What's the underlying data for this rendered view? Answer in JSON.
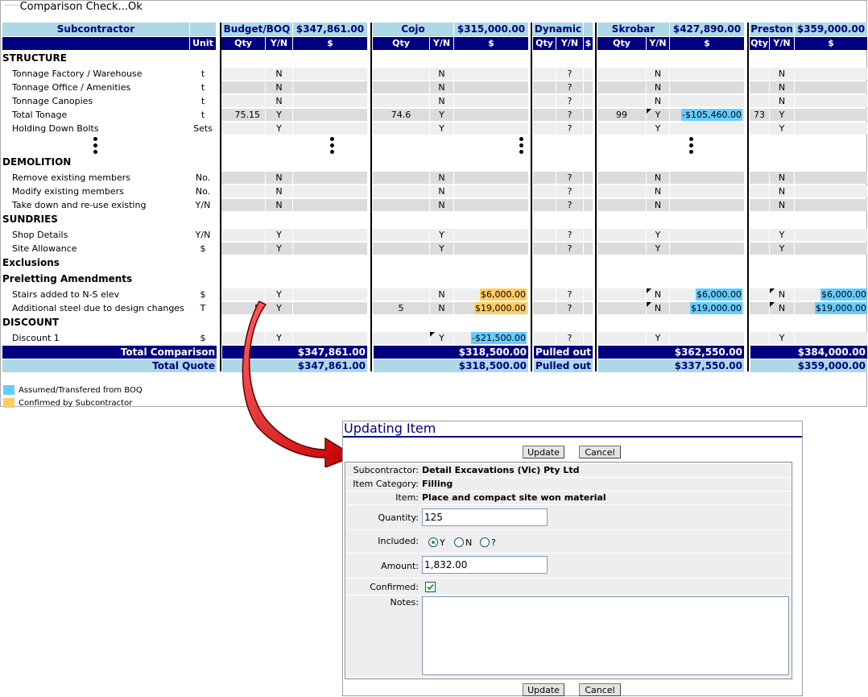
{
  "title": "Comparison Check...Ok",
  "header": {
    "subcontractor_label": "Subcontractor",
    "unit_label": "Unit",
    "groups": [
      {
        "name": "Budget/BOQ",
        "total": "$347,861.00"
      },
      {
        "name": "Cojo",
        "total": "$315,000.00"
      },
      {
        "name": "Dynamic",
        "total": ""
      },
      {
        "name": "Skrobar",
        "total": "$427,890.00"
      },
      {
        "name": "Preston",
        "total": "$359,000.00"
      }
    ],
    "col_qty": "Qty",
    "col_yn": "Y/N",
    "col_dollar": "$"
  },
  "sections": {
    "structure": "STRUCTURE",
    "demolition": "DEMOLITION",
    "sundries": "SUNDRIES",
    "exclusions": "Exclusions",
    "preletting": "Preletting Amendments",
    "discount": "DISCOUNT"
  },
  "rows": [
    {
      "label": "Tonnage Factory / Warehouse",
      "unit": "t",
      "b_qty": "",
      "b_yn": "N",
      "c_qty": "",
      "c_yn": "N",
      "c_amt": "",
      "d_yn": "?",
      "s_qty": "",
      "s_yn": "N",
      "s_amt": "",
      "p_qty": "",
      "p_yn": "N",
      "p_amt": ""
    },
    {
      "label": "Tonnage Office / Amenities",
      "unit": "t",
      "b_qty": "",
      "b_yn": "N",
      "c_qty": "",
      "c_yn": "N",
      "c_amt": "",
      "d_yn": "?",
      "s_qty": "",
      "s_yn": "N",
      "s_amt": "",
      "p_qty": "",
      "p_yn": "N",
      "p_amt": ""
    },
    {
      "label": "Tonnage Canopies",
      "unit": "t",
      "b_qty": "",
      "b_yn": "N",
      "c_qty": "",
      "c_yn": "N",
      "c_amt": "",
      "d_yn": "?",
      "s_qty": "",
      "s_yn": "N",
      "s_amt": "",
      "p_qty": "",
      "p_yn": "N",
      "p_amt": ""
    },
    {
      "label": "Total Tonage",
      "unit": "t",
      "b_qty": "75.15",
      "b_yn": "Y",
      "c_qty": "74.6",
      "c_yn": "Y",
      "c_amt": "",
      "d_yn": "?",
      "s_qty": "99",
      "s_yn": "Y",
      "s_amt": "-$105,460.00",
      "p_qty": "73",
      "p_yn": "Y",
      "p_amt": ""
    },
    {
      "label": "Holding Down Bolts",
      "unit": "Sets",
      "b_qty": "",
      "b_yn": "Y",
      "c_qty": "",
      "c_yn": "Y",
      "c_amt": "",
      "d_yn": "?",
      "s_qty": "",
      "s_yn": "Y",
      "s_amt": "",
      "p_qty": "",
      "p_yn": "Y",
      "p_amt": ""
    },
    {
      "label": "Remove existing members",
      "unit": "No.",
      "b_qty": "",
      "b_yn": "N",
      "c_qty": "",
      "c_yn": "N",
      "c_amt": "",
      "d_yn": "?",
      "s_qty": "",
      "s_yn": "N",
      "s_amt": "",
      "p_qty": "",
      "p_yn": "N",
      "p_amt": ""
    },
    {
      "label": "Modify existing members",
      "unit": "No.",
      "b_qty": "",
      "b_yn": "N",
      "c_qty": "",
      "c_yn": "N",
      "c_amt": "",
      "d_yn": "?",
      "s_qty": "",
      "s_yn": "N",
      "s_amt": "",
      "p_qty": "",
      "p_yn": "N",
      "p_amt": ""
    },
    {
      "label": "Take down and re-use existing",
      "unit": "Y/N",
      "b_qty": "",
      "b_yn": "N",
      "c_qty": "",
      "c_yn": "N",
      "c_amt": "",
      "d_yn": "?",
      "s_qty": "",
      "s_yn": "N",
      "s_amt": "",
      "p_qty": "",
      "p_yn": "N",
      "p_amt": ""
    },
    {
      "label": "Shop Details",
      "unit": "Y/N",
      "b_qty": "",
      "b_yn": "Y",
      "c_qty": "",
      "c_yn": "Y",
      "c_amt": "",
      "d_yn": "?",
      "s_qty": "",
      "s_yn": "Y",
      "s_amt": "",
      "p_qty": "",
      "p_yn": "Y",
      "p_amt": ""
    },
    {
      "label": "Site Allowance",
      "unit": "$",
      "b_qty": "",
      "b_yn": "Y",
      "c_qty": "",
      "c_yn": "Y",
      "c_amt": "",
      "d_yn": "?",
      "s_qty": "",
      "s_yn": "Y",
      "s_amt": "",
      "p_qty": "",
      "p_yn": "Y",
      "p_amt": ""
    },
    {
      "label": "Stairs added to N-S elev",
      "unit": "$",
      "b_qty": "",
      "b_yn": "Y",
      "c_qty": "",
      "c_yn": "N",
      "c_amt": "$6,000.00",
      "d_yn": "?",
      "s_qty": "",
      "s_yn": "N",
      "s_amt": "$6,000.00",
      "p_qty": "",
      "p_yn": "N",
      "p_amt": "$6,000.00"
    },
    {
      "label": "Additional steel due to design changes",
      "unit": "T",
      "b_qty": "5",
      "b_yn": "Y",
      "c_qty": "5",
      "c_yn": "N",
      "c_amt": "$19,000.00",
      "d_yn": "?",
      "s_qty": "",
      "s_yn": "N",
      "s_amt": "$19,000.00",
      "p_qty": "",
      "p_yn": "N",
      "p_amt": "$19,000.00"
    },
    {
      "label": "Discount 1",
      "unit": "$",
      "b_qty": "",
      "b_yn": "Y",
      "c_qty": "",
      "c_yn": "Y",
      "c_amt": "-$21,500.00",
      "d_yn": "?",
      "s_qty": "",
      "s_yn": "Y",
      "s_amt": "",
      "p_qty": "",
      "p_yn": "Y",
      "p_amt": ""
    }
  ],
  "totals": {
    "comparison_label": "Total Comparison",
    "quote_label": "Total Quote",
    "comparison": [
      "$347,861.00",
      "$318,500.00",
      "Pulled out",
      "$362,550.00",
      "$384,000.00"
    ],
    "quote": [
      "$347,861.00",
      "$318,500.00",
      "Pulled out",
      "$337,550.00",
      "$359,000.00"
    ]
  },
  "legend": {
    "assumed": "Assumed/Transfered from BOQ",
    "confirmed": "Confirmed by Subcontractor",
    "assumed_color": "#66ccff",
    "confirmed_color": "#ffcc66"
  },
  "popup": {
    "title": "Updating Item",
    "update_label": "Update",
    "cancel_label": "Cancel",
    "subcontractor_label": "Subcontractor:",
    "subcontractor_value": "Detail Excavations (Vic) Pty Ltd",
    "category_label": "Item Category:",
    "category_value": "Filling",
    "item_label": "Item:",
    "item_value": "Place and compact site won material",
    "quantity_label": "Quantity:",
    "quantity_value": "125",
    "included_label": "Included:",
    "included_options": [
      "Y",
      "N",
      "?"
    ],
    "included_selected": "Y",
    "amount_label": "Amount:",
    "amount_value": "1,832.00",
    "confirmed_label": "Confirmed:",
    "confirmed_checked": true,
    "notes_label": "Notes:",
    "notes_value": ""
  },
  "colors": {
    "navy": "#000080",
    "light_blue": "#add8e6",
    "arrow_red": "#e01010"
  }
}
